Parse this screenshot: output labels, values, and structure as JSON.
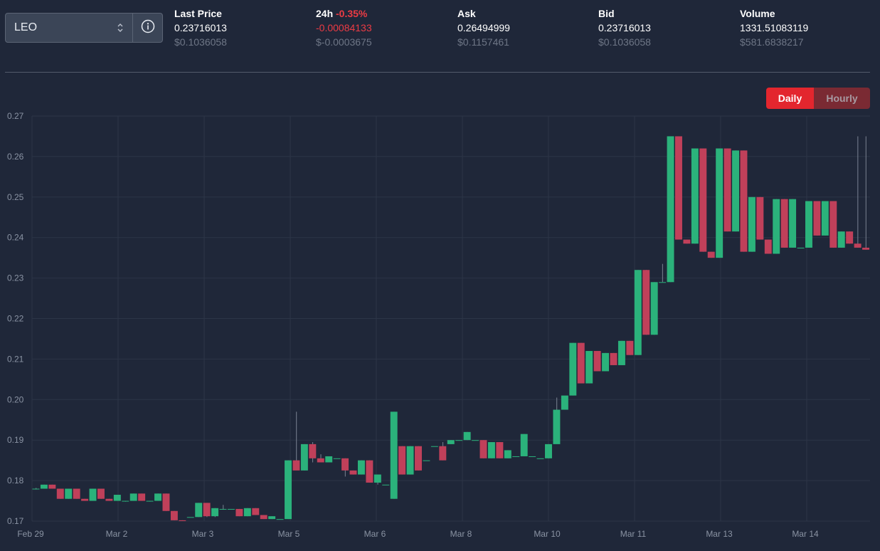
{
  "token_select": {
    "value": "LEO",
    "icon": "chevron-updown-icon",
    "info_icon": "info-icon"
  },
  "stats": {
    "last_price": {
      "label": "Last Price",
      "value": "0.23716013",
      "usd": "$0.1036058"
    },
    "change_24h": {
      "label": "24h",
      "percent": "-0.35%",
      "value": "-0.00084133",
      "usd": "$-0.0003675"
    },
    "ask": {
      "label": "Ask",
      "value": "0.26494999",
      "usd": "$0.1157461"
    },
    "bid": {
      "label": "Bid",
      "value": "0.23716013",
      "usd": "$0.1036058"
    },
    "volume": {
      "label": "Volume",
      "value": "1331.51083119",
      "usd": "$581.6838217"
    }
  },
  "toggle": {
    "daily": "Daily",
    "hourly": "Hourly",
    "active": "daily"
  },
  "colors": {
    "up": "#2bb27b",
    "down": "#c0405a",
    "accent": "#e3262e",
    "background": "#1f2739"
  },
  "chart_data": {
    "type": "candlestick",
    "y_ticks": [
      "0.17",
      "0.18",
      "0.19",
      "0.20",
      "0.21",
      "0.22",
      "0.23",
      "0.24",
      "0.25",
      "0.26",
      "0.27"
    ],
    "ylim": [
      0.17,
      0.27
    ],
    "x_ticks": [
      "Feb 29",
      "Mar 2",
      "Mar 3",
      "Mar 5",
      "Mar 6",
      "Mar 8",
      "Mar 10",
      "Mar 11",
      "Mar 13",
      "Mar 14"
    ],
    "grid": true,
    "series": [
      {
        "ohlc": [
          [
            0.178,
            0.1782,
            0.1778,
            0.178
          ],
          [
            0.178,
            0.179,
            0.178,
            0.179
          ],
          [
            0.179,
            0.179,
            0.178,
            0.178
          ],
          [
            0.178,
            0.178,
            0.1755,
            0.1755
          ],
          [
            0.1755,
            0.178,
            0.1755,
            0.178
          ],
          [
            0.178,
            0.178,
            0.1755,
            0.1755
          ],
          [
            0.1755,
            0.1755,
            0.175,
            0.175
          ],
          [
            0.175,
            0.178,
            0.175,
            0.178
          ],
          [
            0.178,
            0.178,
            0.1755,
            0.1755
          ],
          [
            0.1755,
            0.1755,
            0.175,
            0.175
          ],
          [
            0.175,
            0.1765,
            0.175,
            0.1765
          ],
          [
            0.175,
            0.175,
            0.1748,
            0.175
          ],
          [
            0.175,
            0.1768,
            0.175,
            0.1768
          ],
          [
            0.1768,
            0.1768,
            0.175,
            0.175
          ],
          [
            0.175,
            0.175,
            0.1748,
            0.175
          ],
          [
            0.175,
            0.1768,
            0.175,
            0.1768
          ],
          [
            0.1768,
            0.1768,
            0.1725,
            0.1725
          ],
          [
            0.1725,
            0.1725,
            0.1702,
            0.1702
          ],
          [
            0.1702,
            0.1702,
            0.17,
            0.17
          ],
          [
            0.171,
            0.171,
            0.171,
            0.171
          ],
          [
            0.171,
            0.1745,
            0.171,
            0.1745
          ],
          [
            0.1745,
            0.1745,
            0.171,
            0.1712
          ],
          [
            0.1712,
            0.1732,
            0.171,
            0.1732
          ],
          [
            0.173,
            0.174,
            0.1728,
            0.173
          ],
          [
            0.173,
            0.173,
            0.173,
            0.173
          ],
          [
            0.173,
            0.173,
            0.1712,
            0.1712
          ],
          [
            0.1712,
            0.1732,
            0.1712,
            0.1732
          ],
          [
            0.1732,
            0.1732,
            0.1715,
            0.1715
          ],
          [
            0.1715,
            0.1715,
            0.1705,
            0.1705
          ],
          [
            0.1705,
            0.1712,
            0.1705,
            0.1712
          ],
          [
            0.1705,
            0.1705,
            0.1705,
            0.1705
          ],
          [
            0.1705,
            0.185,
            0.1705,
            0.185
          ],
          [
            0.185,
            0.197,
            0.1835,
            0.1825
          ],
          [
            0.1825,
            0.189,
            0.1825,
            0.189
          ],
          [
            0.189,
            0.1895,
            0.1845,
            0.1855
          ],
          [
            0.1855,
            0.1865,
            0.1845,
            0.1845
          ],
          [
            0.1845,
            0.186,
            0.1845,
            0.186
          ],
          [
            0.1855,
            0.1855,
            0.1855,
            0.1855
          ],
          [
            0.1855,
            0.1855,
            0.181,
            0.1825
          ],
          [
            0.1825,
            0.1825,
            0.1815,
            0.1815
          ],
          [
            0.1815,
            0.185,
            0.1815,
            0.185
          ],
          [
            0.185,
            0.185,
            0.1795,
            0.1795
          ],
          [
            0.1795,
            0.1815,
            0.179,
            0.1815
          ],
          [
            0.179,
            0.179,
            0.179,
            0.179
          ],
          [
            0.1755,
            0.197,
            0.1755,
            0.197
          ],
          [
            0.1885,
            0.1885,
            0.1815,
            0.1815
          ],
          [
            0.1815,
            0.1885,
            0.1815,
            0.1885
          ],
          [
            0.1885,
            0.1885,
            0.1825,
            0.1825
          ],
          [
            0.185,
            0.185,
            0.185,
            0.185
          ],
          [
            0.1885,
            0.1885,
            0.1885,
            0.1885
          ],
          [
            0.1885,
            0.1895,
            0.185,
            0.185
          ],
          [
            0.189,
            0.19,
            0.189,
            0.19
          ],
          [
            0.19,
            0.19,
            0.19,
            0.19
          ],
          [
            0.19,
            0.192,
            0.19,
            0.192
          ],
          [
            0.19,
            0.19,
            0.19,
            0.19
          ],
          [
            0.19,
            0.19,
            0.1855,
            0.1855
          ],
          [
            0.1855,
            0.1895,
            0.1855,
            0.1895
          ],
          [
            0.1895,
            0.1895,
            0.1855,
            0.1855
          ],
          [
            0.1855,
            0.1875,
            0.1855,
            0.1875
          ],
          [
            0.186,
            0.186,
            0.186,
            0.186
          ],
          [
            0.186,
            0.1915,
            0.186,
            0.1915
          ],
          [
            0.186,
            0.186,
            0.186,
            0.186
          ],
          [
            0.1855,
            0.1855,
            0.1855,
            0.1855
          ],
          [
            0.1855,
            0.189,
            0.1855,
            0.189
          ],
          [
            0.189,
            0.2005,
            0.1895,
            0.1975
          ],
          [
            0.1975,
            0.2005,
            0.1995,
            0.201
          ],
          [
            0.201,
            0.214,
            0.201,
            0.214
          ],
          [
            0.214,
            0.214,
            0.204,
            0.204
          ],
          [
            0.204,
            0.212,
            0.204,
            0.212
          ],
          [
            0.212,
            0.212,
            0.207,
            0.207
          ],
          [
            0.207,
            0.2115,
            0.207,
            0.2115
          ],
          [
            0.2115,
            0.2115,
            0.2085,
            0.2085
          ],
          [
            0.2085,
            0.2145,
            0.2085,
            0.2145
          ],
          [
            0.2145,
            0.2145,
            0.211,
            0.211
          ],
          [
            0.211,
            0.232,
            0.211,
            0.232
          ],
          [
            0.232,
            0.232,
            0.216,
            0.216
          ],
          [
            0.216,
            0.229,
            0.216,
            0.229
          ],
          [
            0.229,
            0.2335,
            0.229,
            0.229
          ],
          [
            0.229,
            0.265,
            0.229,
            0.265
          ],
          [
            0.265,
            0.265,
            0.2395,
            0.2395
          ],
          [
            0.2395,
            0.2395,
            0.2385,
            0.2385
          ],
          [
            0.2385,
            0.262,
            0.2385,
            0.262
          ],
          [
            0.262,
            0.262,
            0.2365,
            0.2365
          ],
          [
            0.2365,
            0.2365,
            0.235,
            0.235
          ],
          [
            0.235,
            0.262,
            0.235,
            0.262
          ],
          [
            0.262,
            0.262,
            0.2415,
            0.2415
          ],
          [
            0.2415,
            0.2615,
            0.2415,
            0.2615
          ],
          [
            0.2615,
            0.2615,
            0.2365,
            0.2365
          ],
          [
            0.2365,
            0.25,
            0.2365,
            0.25
          ],
          [
            0.25,
            0.25,
            0.2395,
            0.2395
          ],
          [
            0.2395,
            0.2395,
            0.236,
            0.236
          ],
          [
            0.236,
            0.2495,
            0.236,
            0.2495
          ],
          [
            0.2495,
            0.2495,
            0.2375,
            0.2375
          ],
          [
            0.2375,
            0.2495,
            0.2375,
            0.2495
          ],
          [
            0.2375,
            0.2375,
            0.2375,
            0.2375
          ],
          [
            0.2375,
            0.249,
            0.2375,
            0.249
          ],
          [
            0.249,
            0.249,
            0.2405,
            0.2405
          ],
          [
            0.2405,
            0.249,
            0.2405,
            0.249
          ],
          [
            0.249,
            0.249,
            0.2375,
            0.2375
          ],
          [
            0.2375,
            0.2415,
            0.2375,
            0.2415
          ],
          [
            0.2415,
            0.2415,
            0.2385,
            0.2385
          ],
          [
            0.2385,
            0.265,
            0.2375,
            0.2375
          ],
          [
            0.2375,
            0.265,
            0.237,
            0.237
          ]
        ]
      }
    ]
  }
}
